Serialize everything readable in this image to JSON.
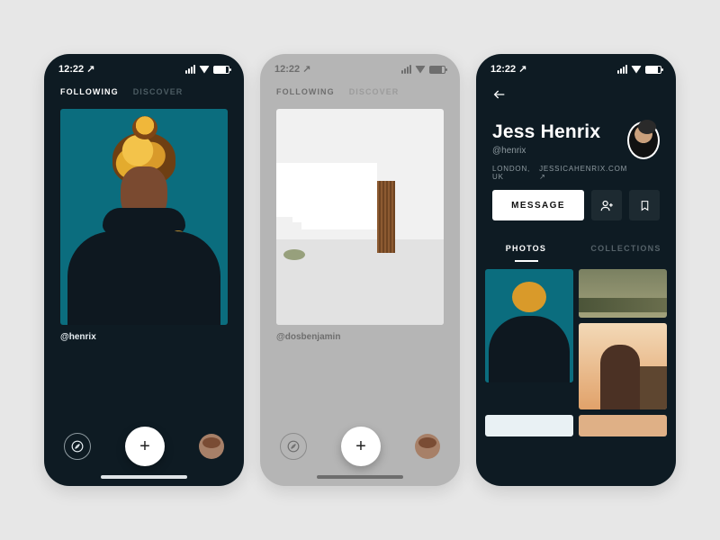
{
  "status": {
    "time": "12:22",
    "location_arrow": "↗"
  },
  "tabs": {
    "following": "FOLLOWING",
    "discover": "DISCOVER"
  },
  "screen1": {
    "caption": "@henrix"
  },
  "screen2": {
    "caption": "@dosbenjamin"
  },
  "profile": {
    "name": "Jess Henrix",
    "handle": "@henrix",
    "location": "LONDON, UK",
    "website": "JESSICAHENRIX.COM",
    "link_glyph": "↗",
    "message_label": "MESSAGE",
    "tabs": {
      "photos": "PHOTOS",
      "collections": "COLLECTIONS"
    }
  },
  "nav": {
    "plus": "+"
  }
}
